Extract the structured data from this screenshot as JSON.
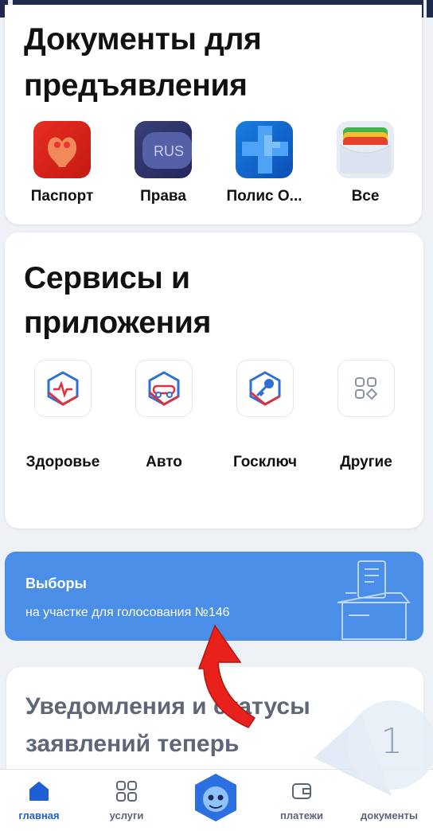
{
  "documents": {
    "title_line1": "Документы для",
    "title_line2": "предъявления",
    "items": [
      {
        "label": "Паспорт",
        "icon": "passport-icon"
      },
      {
        "label": "Права",
        "icon": "drivers-license-icon",
        "icon_text": "RUS"
      },
      {
        "label": "Полис О...",
        "icon": "insurance-policy-icon"
      },
      {
        "label": "Все",
        "icon": "wallet-icon"
      }
    ]
  },
  "services": {
    "title_line1": "Сервисы и",
    "title_line2": "приложения",
    "items": [
      {
        "label": "Здоровье",
        "icon": "health-icon"
      },
      {
        "label": "Авто",
        "icon": "car-icon"
      },
      {
        "label": "Госключ",
        "icon": "key-icon"
      },
      {
        "label": "Другие",
        "icon": "apps-grid-icon"
      }
    ]
  },
  "banner": {
    "title": "Выборы",
    "subtitle": "на участке для голосования №146",
    "color": "#4a8ee8"
  },
  "notifications": {
    "title_line1": "Уведомления и статусы",
    "title_line2": "заявлений теперь"
  },
  "tabbar": {
    "items": [
      {
        "label": "главная",
        "active": true
      },
      {
        "label": "услуги",
        "active": false
      },
      {
        "label": "платежи",
        "active": false
      },
      {
        "label": "документы",
        "active": false
      }
    ]
  },
  "overlay": {
    "digit": "1"
  },
  "colors": {
    "accent": "#1f5fd6",
    "arrow": "#e8211a"
  }
}
